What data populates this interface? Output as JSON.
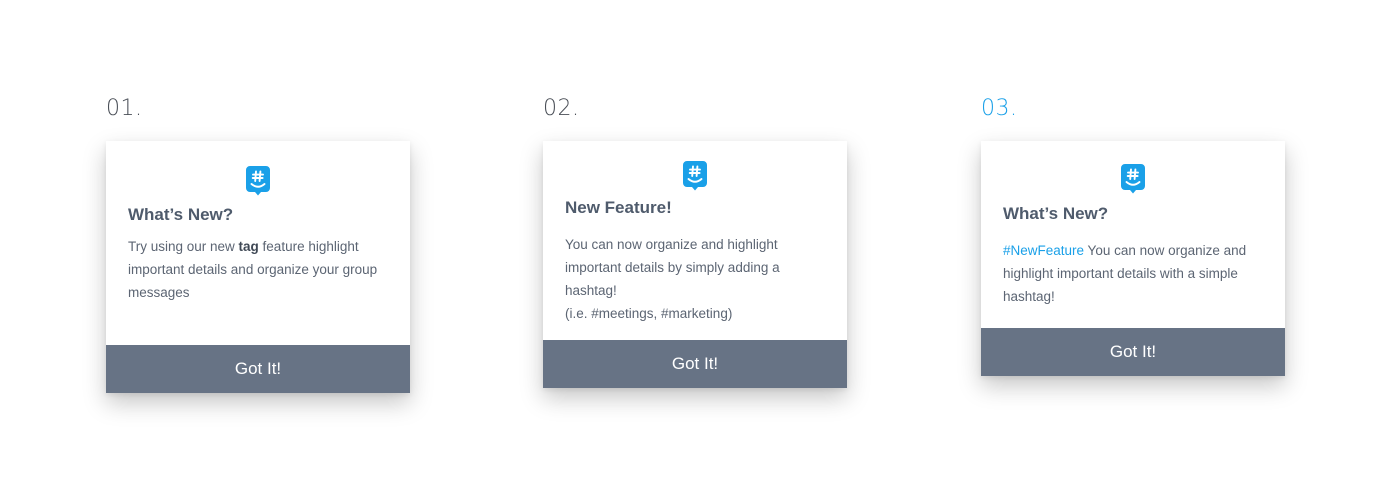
{
  "variants": [
    {
      "number": "01.",
      "title": "What’s New?",
      "body_before": "Try using our new ",
      "body_bold": "tag",
      "body_after": " feature highlight important details and organize your group messages",
      "button_label": "Got It!"
    },
    {
      "number": "02.",
      "title": "New Feature!",
      "body_line1": "You can now organize and highlight important details by simply adding a hashtag!",
      "body_line2": "(i.e. #meetings, #marketing)",
      "button_label": "Got It!"
    },
    {
      "number": "03.",
      "title": "What’s New?",
      "body_hashtag": "#NewFeature",
      "body_rest": " You can now organize and highlight important details with a simple hashtag!",
      "button_label": "Got It!"
    }
  ],
  "icons": {
    "logo": "groupme-hashtag-logo-icon"
  },
  "colors": {
    "accent": "#1aa0e8",
    "button": "#677385",
    "title": "#4f5b6c",
    "body": "#5c6573"
  }
}
